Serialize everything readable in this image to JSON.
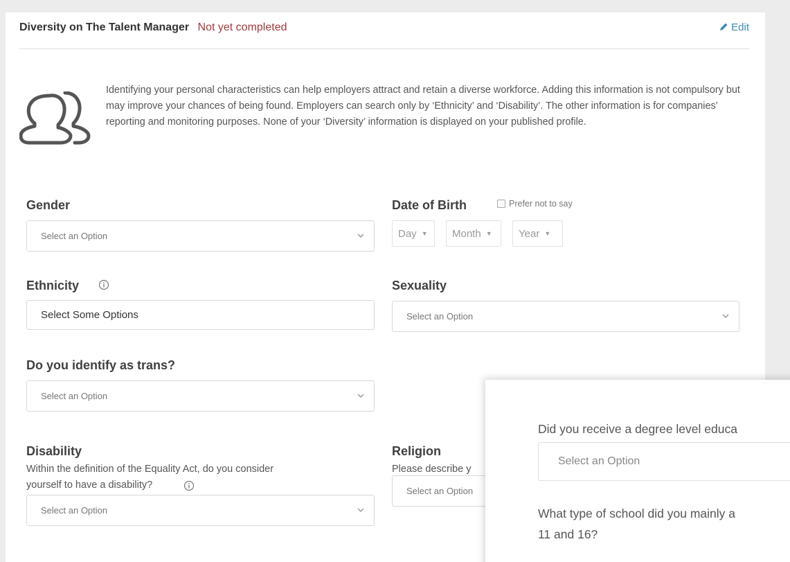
{
  "header": {
    "title": "Diversity on The Talent Manager",
    "status": "Not yet completed",
    "edit_label": "Edit"
  },
  "intro_text": "Identifying your personal characteristics can help employers attract and retain a diverse workforce. Adding this information is not compulsory but may improve your chances of being found. Employers can search only by ‘Ethnicity’ and ‘Disability’. The other information is for companies’ reporting and monitoring purposes. None of your ‘Diversity’ information is displayed on your published profile.",
  "gender": {
    "label": "Gender",
    "value": "Select an Option"
  },
  "dob": {
    "label": "Date of Birth",
    "prefer_label": "Prefer not to say",
    "day": "Day",
    "month": "Month",
    "year": "Year"
  },
  "ethnicity": {
    "label": "Ethnicity",
    "value": "Select Some Options"
  },
  "sexuality": {
    "label": "Sexuality",
    "value": "Select an Option"
  },
  "trans": {
    "label": "Do you identify as trans?",
    "value": "Select an Option"
  },
  "disability": {
    "label": "Disability",
    "help_line1": "Within the definition of the Equality Act, do you consider",
    "help_line2": "yourself to have a disability?",
    "value": "Select an Option"
  },
  "religion": {
    "label": "Religion",
    "help": "Please describe y",
    "value": "Select an Option"
  },
  "overlay": {
    "q1": "Did you receive a degree level educa",
    "q1_value": "Select an Option",
    "q2_line1": "What type of school did you mainly a",
    "q2_line2": "11 and 16?"
  },
  "colors": {
    "status": "#a23a3a",
    "link": "#3a8ab7",
    "border": "#d8d8d8"
  }
}
